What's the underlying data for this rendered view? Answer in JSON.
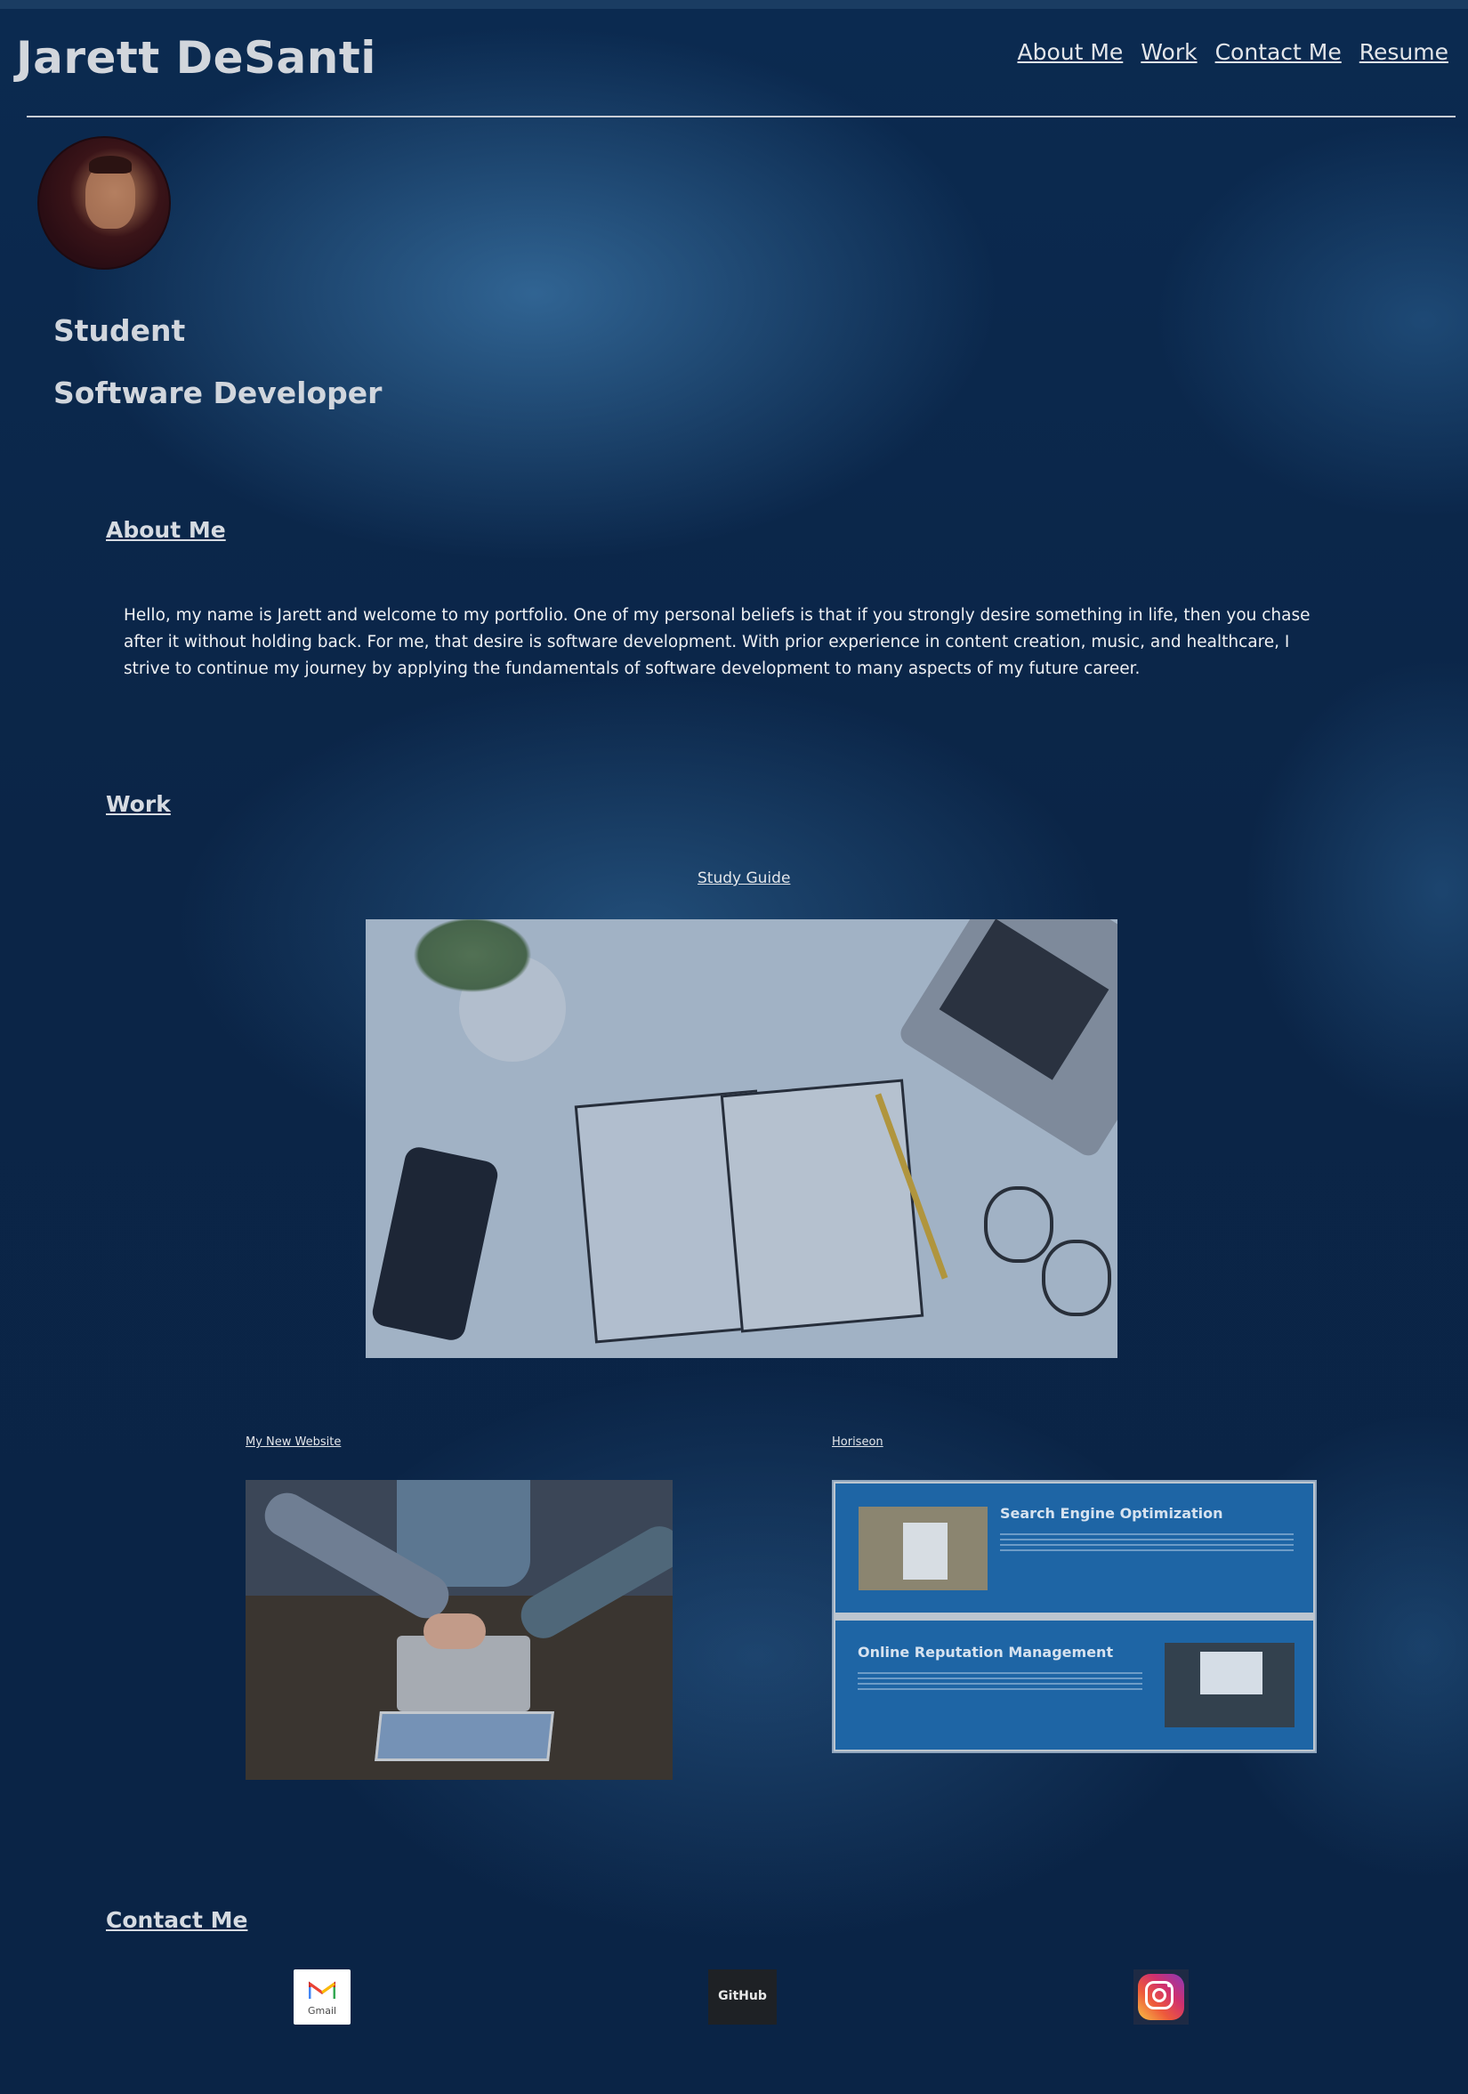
{
  "header": {
    "site_title": "Jarett DeSanti",
    "nav": [
      "About Me",
      "Work",
      "Contact Me",
      "Resume"
    ]
  },
  "hero": {
    "roles": [
      "Student",
      "Software Developer"
    ]
  },
  "about": {
    "heading": "About Me",
    "text": "Hello, my name is Jarett and welcome to my portfolio. One of my personal beliefs is that if you strongly desire something in life, then you chase after it without holding back. For me, that desire is software development. With prior experience in content creation, music, and healthcare, I strive to continue my journey by applying the fundamentals of software development to many aspects of my future career."
  },
  "work": {
    "heading": "Work",
    "projects": [
      {
        "title": "Study Guide"
      },
      {
        "title": "My New Website"
      },
      {
        "title": "Horiseon"
      }
    ],
    "horiseon_preview": {
      "panel1_title": "Search Engine Optimization",
      "panel2_title": "Online Reputation Management"
    }
  },
  "contact": {
    "heading": "Contact Me",
    "links": [
      {
        "label": "Gmail",
        "icon": "gmail-icon"
      },
      {
        "label": "GitHub",
        "icon": "github-icon"
      },
      {
        "label": "Instagram",
        "icon": "instagram-icon"
      }
    ]
  },
  "colors": {
    "background": "#0b2547",
    "text": "#d9dde4",
    "rule": "#c9ced6"
  }
}
